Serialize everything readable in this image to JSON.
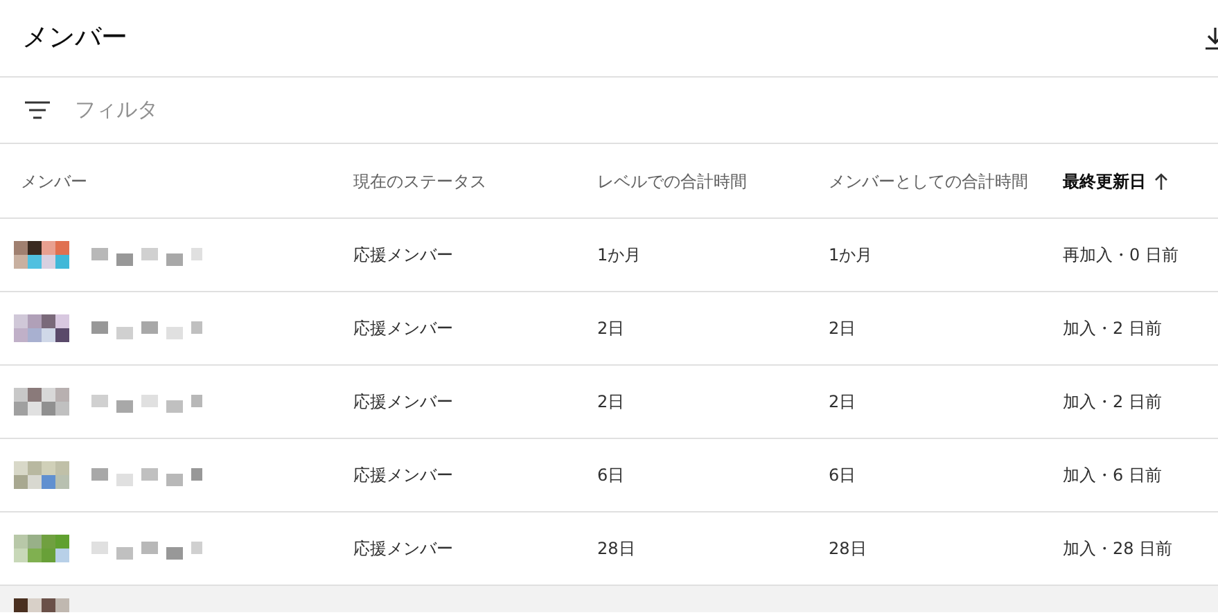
{
  "title": "メンバー",
  "filter": {
    "placeholder": "フィルタ"
  },
  "table": {
    "columns": [
      {
        "label": "メンバー",
        "sorted": false
      },
      {
        "label": "現在のステータス",
        "sorted": false
      },
      {
        "label": "レベルでの合計時間",
        "sorted": false
      },
      {
        "label": "メンバーとしての合計時間",
        "sorted": false
      },
      {
        "label": "最終更新日",
        "sorted": true
      }
    ],
    "rows": [
      {
        "status": "応援メンバー",
        "level_time": "1か月",
        "member_time": "1か月",
        "last_updated": "再加入・0 日前",
        "highlighted": false
      },
      {
        "status": "応援メンバー",
        "level_time": "2日",
        "member_time": "2日",
        "last_updated": "加入・2 日前",
        "highlighted": false
      },
      {
        "status": "応援メンバー",
        "level_time": "2日",
        "member_time": "2日",
        "last_updated": "加入・2 日前",
        "highlighted": false
      },
      {
        "status": "応援メンバー",
        "level_time": "6日",
        "member_time": "6日",
        "last_updated": "加入・6 日前",
        "highlighted": false
      },
      {
        "status": "応援メンバー",
        "level_time": "28日",
        "member_time": "28日",
        "last_updated": "加入・28 日前",
        "highlighted": false
      },
      {
        "highlighted": true
      }
    ]
  }
}
